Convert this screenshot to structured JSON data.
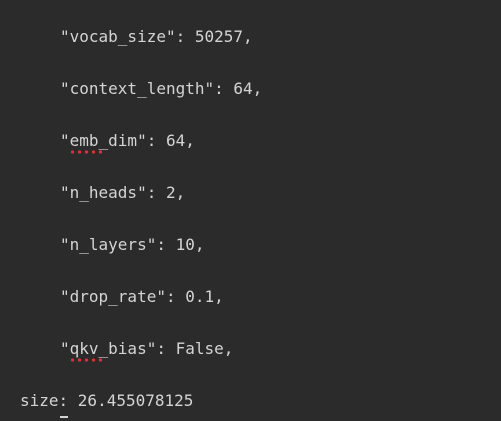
{
  "config_lines": [
    "\"vocab_size\": 50257,",
    "\"context_length\": 64,",
    "\"emb_dim\": 64,",
    "\"n_heads\": 2,",
    "\"n_layers\": 10,",
    "\"drop_rate\": 0.1,",
    "\"qkv_bias\": False,"
  ],
  "output": {
    "size_line": "size: 26.455078125"
  },
  "colors": {
    "background": "#2b2b2b",
    "text": "#d4d4d4",
    "spellcheck_underline": "#e03030"
  }
}
